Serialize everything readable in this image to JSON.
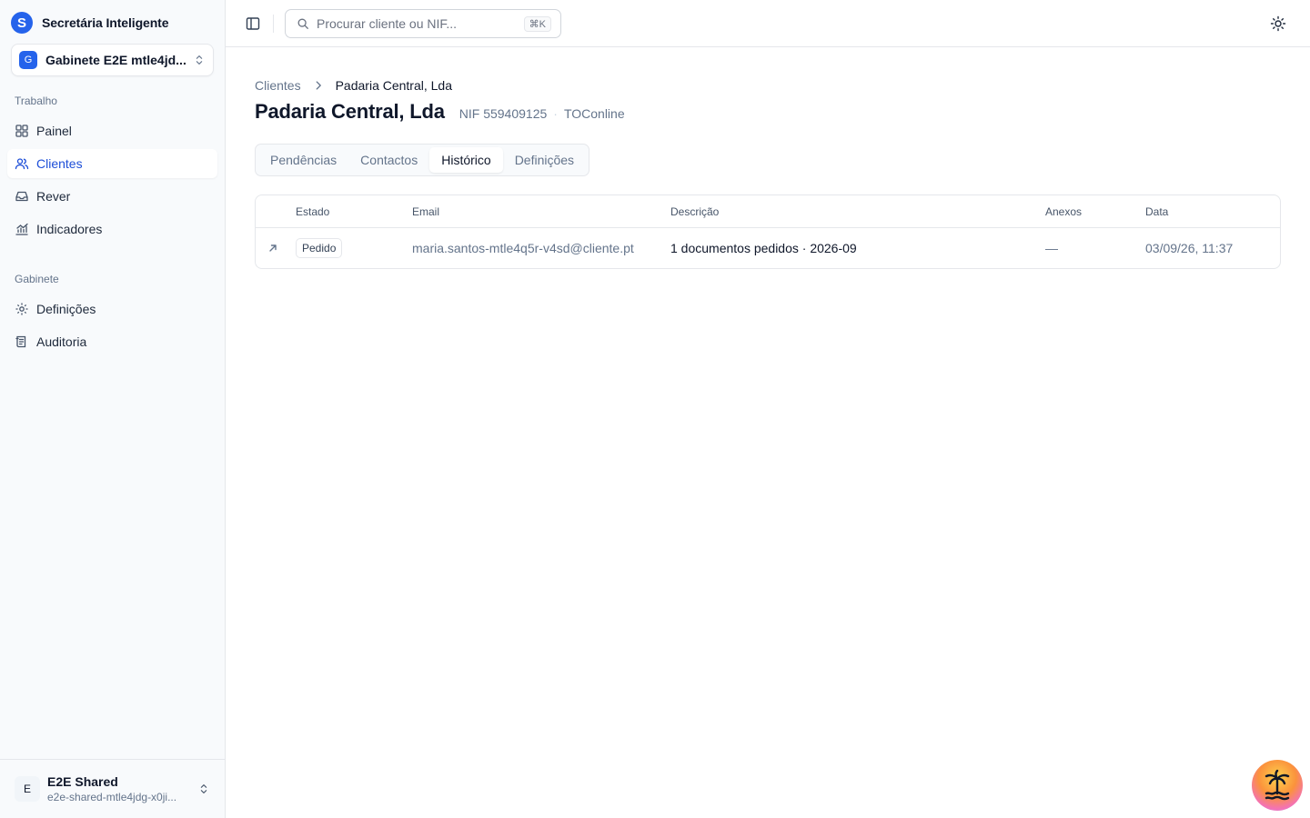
{
  "app": {
    "brand_letter": "S",
    "name": "Secretária Inteligente"
  },
  "office": {
    "badge": "G",
    "name": "Gabinete E2E mtle4jd..."
  },
  "sidebar": {
    "work_label": "Trabalho",
    "work_items": [
      {
        "label": "Painel",
        "icon": "grid-icon"
      },
      {
        "label": "Clientes",
        "icon": "users-icon",
        "active": true
      },
      {
        "label": "Rever",
        "icon": "inbox-icon"
      },
      {
        "label": "Indicadores",
        "icon": "chart-icon"
      }
    ],
    "office_label": "Gabinete",
    "office_items": [
      {
        "label": "Definições",
        "icon": "gear-icon"
      },
      {
        "label": "Auditoria",
        "icon": "log-icon"
      }
    ]
  },
  "user": {
    "initial": "E",
    "name": "E2E Shared",
    "email": "e2e-shared-mtle4jdg-x0ji..."
  },
  "search": {
    "placeholder": "Procurar cliente ou NIF...",
    "shortcut": "⌘K"
  },
  "breadcrumb": {
    "parent": "Clientes",
    "current": "Padaria Central, Lda"
  },
  "client": {
    "name": "Padaria Central, Lda",
    "nif": "NIF 559409125",
    "separator": "·",
    "provider": "TOConline"
  },
  "tabs": [
    {
      "label": "Pendências"
    },
    {
      "label": "Contactos"
    },
    {
      "label": "Histórico",
      "active": true
    },
    {
      "label": "Definições"
    }
  ],
  "table": {
    "headers": {
      "status": "Estado",
      "email": "Email",
      "description": "Descrição",
      "attachments": "Anexos",
      "date": "Data"
    },
    "rows": [
      {
        "direction_icon": "arrow-up-right-icon",
        "status": "Pedido",
        "email": "maria.santos-mtle4q5r-v4sd@cliente.pt",
        "description": "1 documentos pedidos · 2026-09",
        "attachments": "—",
        "date": "03/09/26, 11:37"
      }
    ]
  },
  "colors": {
    "accent": "#2563eb",
    "active_text": "#1d4ed8",
    "muted": "#64748b",
    "border": "#e5e7eb",
    "sidebar_bg": "#f8fafc"
  }
}
